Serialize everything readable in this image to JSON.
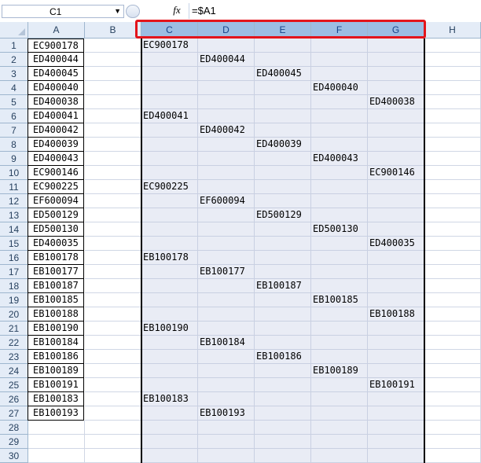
{
  "formula_bar": {
    "name_box": "C1",
    "fx_label": "fx",
    "formula": "=$A1"
  },
  "columns": [
    "A",
    "B",
    "C",
    "D",
    "E",
    "F",
    "G",
    "H"
  ],
  "selected_columns": [
    "C",
    "D",
    "E",
    "F",
    "G"
  ],
  "rows": [
    "1",
    "2",
    "3",
    "4",
    "5",
    "6",
    "7",
    "8",
    "9",
    "10",
    "11",
    "12",
    "13",
    "14",
    "15",
    "16",
    "17",
    "18",
    "19",
    "20",
    "21",
    "22",
    "23",
    "24",
    "25",
    "26",
    "27",
    "28",
    "29",
    "30"
  ],
  "column_a": [
    "EC900178",
    "ED400044",
    "ED400045",
    "ED400040",
    "ED400038",
    "ED400041",
    "ED400042",
    "ED400039",
    "ED400043",
    "EC900146",
    "EC900225",
    "EF600094",
    "ED500129",
    "ED500130",
    "ED400035",
    "EB100178",
    "EB100177",
    "EB100187",
    "EB100185",
    "EB100188",
    "EB100190",
    "EB100184",
    "EB100186",
    "EB100189",
    "EB100191",
    "EB100183",
    "EB100193"
  ],
  "distributed": [
    {
      "row": 1,
      "col": "C",
      "value": "EC900178"
    },
    {
      "row": 2,
      "col": "D",
      "value": "ED400044"
    },
    {
      "row": 3,
      "col": "E",
      "value": "ED400045"
    },
    {
      "row": 4,
      "col": "F",
      "value": "ED400040"
    },
    {
      "row": 5,
      "col": "G",
      "value": "ED400038"
    },
    {
      "row": 6,
      "col": "C",
      "value": "ED400041"
    },
    {
      "row": 7,
      "col": "D",
      "value": "ED400042"
    },
    {
      "row": 8,
      "col": "E",
      "value": "ED400039"
    },
    {
      "row": 9,
      "col": "F",
      "value": "ED400043"
    },
    {
      "row": 10,
      "col": "G",
      "value": "EC900146"
    },
    {
      "row": 11,
      "col": "C",
      "value": "EC900225"
    },
    {
      "row": 12,
      "col": "D",
      "value": "EF600094"
    },
    {
      "row": 13,
      "col": "E",
      "value": "ED500129"
    },
    {
      "row": 14,
      "col": "F",
      "value": "ED500130"
    },
    {
      "row": 15,
      "col": "G",
      "value": "ED400035"
    },
    {
      "row": 16,
      "col": "C",
      "value": "EB100178"
    },
    {
      "row": 17,
      "col": "D",
      "value": "EB100177"
    },
    {
      "row": 18,
      "col": "E",
      "value": "EB100187"
    },
    {
      "row": 19,
      "col": "F",
      "value": "EB100185"
    },
    {
      "row": 20,
      "col": "G",
      "value": "EB100188"
    },
    {
      "row": 21,
      "col": "C",
      "value": "EB100190"
    },
    {
      "row": 22,
      "col": "D",
      "value": "EB100184"
    },
    {
      "row": 23,
      "col": "E",
      "value": "EB100186"
    },
    {
      "row": 24,
      "col": "F",
      "value": "EB100189"
    },
    {
      "row": 25,
      "col": "G",
      "value": "EB100191"
    },
    {
      "row": 26,
      "col": "C",
      "value": "EB100183"
    },
    {
      "row": 27,
      "col": "D",
      "value": "EB100193"
    }
  ],
  "colors": {
    "selection_fill": "#e9ecf5",
    "header_fill": "#e4ecf7",
    "selected_header_fill": "#9cbde3",
    "highlight_frame": "#e3141b"
  }
}
